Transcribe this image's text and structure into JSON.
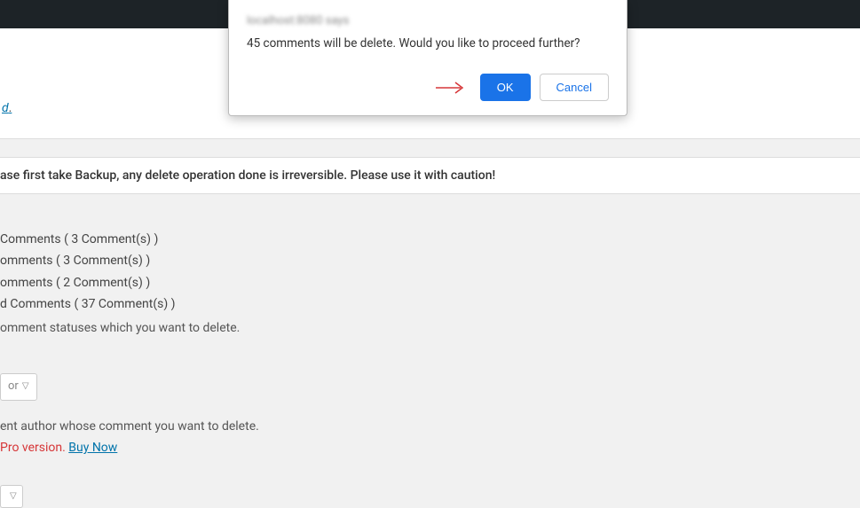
{
  "dialog": {
    "origin": "localhost:8080 says",
    "message": "45 comments will be delete. Would you like to proceed further?",
    "ok": "OK",
    "cancel": "Cancel"
  },
  "page": {
    "link_fragment": "d",
    "warning": "ase first take Backup, any delete operation done is irreversible. Please use it with caution!",
    "lines": {
      "l1": " Comments ( 3 Comment(s) )",
      "l2": "omments ( 3 Comment(s) )",
      "l3": "omments ( 2 Comment(s) )",
      "l4": "d Comments ( 37 Comment(s) )",
      "hint": "omment statuses which you want to delete."
    },
    "select1": "or",
    "desc": "ent author whose comment you want to delete.",
    "pro_prefix": "Pro version. ",
    "buy_now": "Buy Now"
  }
}
